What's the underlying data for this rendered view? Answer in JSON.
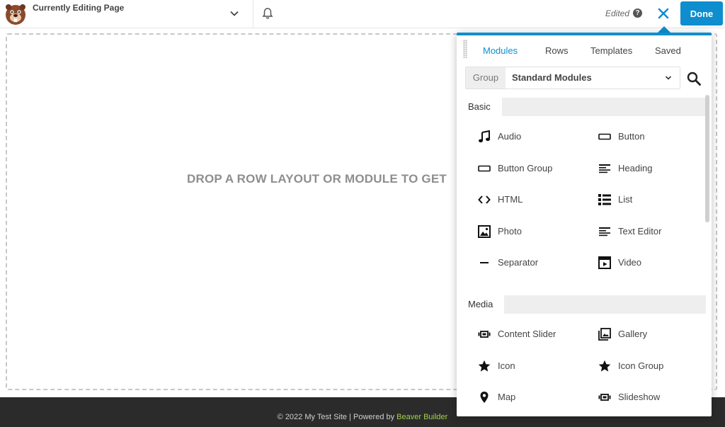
{
  "topbar": {
    "page_title": "Currently Editing Page",
    "status": "Edited",
    "help_glyph": "?",
    "done_label": "Done"
  },
  "canvas": {
    "drop_text": "DROP A ROW LAYOUT OR MODULE TO GET"
  },
  "footer": {
    "text": "© 2022 My Test Site | Powered by",
    "link": "Beaver Builder"
  },
  "panel": {
    "tabs": [
      "Modules",
      "Rows",
      "Templates",
      "Saved"
    ],
    "active_tab": "Modules",
    "group_label": "Group",
    "group_value": "Standard Modules",
    "sections": [
      {
        "title": "Basic",
        "modules": [
          {
            "label": "Audio",
            "icon": "music-note-icon"
          },
          {
            "label": "Button",
            "icon": "button-icon"
          },
          {
            "label": "Button Group",
            "icon": "button-group-icon"
          },
          {
            "label": "Heading",
            "icon": "heading-icon"
          },
          {
            "label": "HTML",
            "icon": "code-icon"
          },
          {
            "label": "List",
            "icon": "list-icon"
          },
          {
            "label": "Photo",
            "icon": "photo-icon"
          },
          {
            "label": "Text Editor",
            "icon": "text-editor-icon"
          },
          {
            "label": "Separator",
            "icon": "separator-icon"
          },
          {
            "label": "Video",
            "icon": "video-icon"
          }
        ]
      },
      {
        "title": "Media",
        "modules": [
          {
            "label": "Content Slider",
            "icon": "content-slider-icon"
          },
          {
            "label": "Gallery",
            "icon": "gallery-icon"
          },
          {
            "label": "Icon",
            "icon": "star-icon"
          },
          {
            "label": "Icon Group",
            "icon": "star-icon"
          },
          {
            "label": "Map",
            "icon": "map-pin-icon"
          },
          {
            "label": "Slideshow",
            "icon": "slideshow-icon"
          }
        ]
      }
    ]
  },
  "colors": {
    "accent": "#0e8ecf",
    "footer_bg": "#2b2b2b",
    "footer_link": "#9fd246"
  }
}
